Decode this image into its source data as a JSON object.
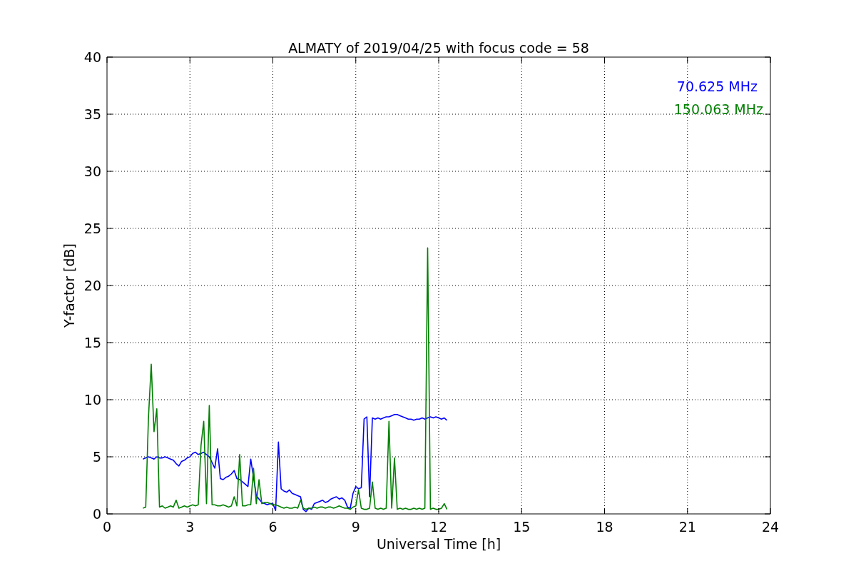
{
  "chart_data": {
    "type": "line",
    "title": "ALMATY of 2019/04/25 with focus code = 58",
    "xlabel": "Universal Time [h]",
    "ylabel": "Y-factor [dB]",
    "xlim": [
      0,
      24
    ],
    "ylim": [
      0,
      40
    ],
    "xticks": [
      0,
      3,
      6,
      9,
      12,
      15,
      18,
      21,
      24
    ],
    "yticks": [
      0,
      5,
      10,
      15,
      20,
      25,
      30,
      35,
      40
    ],
    "grid": true,
    "x": [
      1.3,
      1.4,
      1.5,
      1.6,
      1.7,
      1.8,
      1.9,
      2.0,
      2.1,
      2.2,
      2.3,
      2.4,
      2.5,
      2.6,
      2.7,
      2.8,
      2.9,
      3.0,
      3.1,
      3.2,
      3.3,
      3.4,
      3.5,
      3.6,
      3.7,
      3.8,
      3.9,
      4.0,
      4.1,
      4.2,
      4.3,
      4.4,
      4.5,
      4.6,
      4.7,
      4.8,
      4.9,
      5.0,
      5.1,
      5.2,
      5.3,
      5.4,
      5.5,
      5.6,
      5.7,
      5.8,
      5.9,
      6.0,
      6.1,
      6.2,
      6.3,
      6.4,
      6.5,
      6.6,
      6.7,
      6.8,
      6.9,
      7.0,
      7.1,
      7.2,
      7.3,
      7.4,
      7.5,
      7.6,
      7.7,
      7.8,
      7.9,
      8.0,
      8.1,
      8.2,
      8.3,
      8.4,
      8.5,
      8.6,
      8.7,
      8.8,
      8.9,
      9.0,
      9.1,
      9.2,
      9.3,
      9.4,
      9.5,
      9.6,
      9.7,
      9.8,
      9.9,
      10.0,
      10.1,
      10.2,
      10.3,
      10.4,
      10.5,
      10.6,
      10.7,
      10.8,
      10.9,
      11.0,
      11.1,
      11.2,
      11.3,
      11.4,
      11.5,
      11.6,
      11.7,
      11.8,
      11.9,
      12.0,
      12.1,
      12.2,
      12.3
    ],
    "series": [
      {
        "name": "70.625 MHz",
        "color": "#0000ff",
        "values": [
          4.8,
          4.9,
          5.0,
          4.9,
          4.8,
          5.0,
          4.9,
          4.9,
          5.0,
          4.9,
          4.8,
          4.7,
          4.4,
          4.2,
          4.6,
          4.7,
          4.9,
          5.0,
          5.3,
          5.4,
          5.2,
          5.3,
          5.4,
          5.2,
          5.0,
          4.5,
          4.0,
          5.7,
          3.1,
          3.0,
          3.2,
          3.3,
          3.5,
          3.8,
          3.1,
          3.0,
          2.8,
          2.6,
          2.4,
          4.8,
          3.2,
          1.6,
          1.3,
          1.0,
          0.9,
          0.8,
          0.9,
          0.9,
          0.3,
          6.3,
          2.2,
          2.0,
          1.9,
          2.1,
          1.8,
          1.7,
          1.6,
          1.5,
          0.4,
          0.2,
          0.5,
          0.4,
          0.9,
          1.0,
          1.1,
          1.2,
          1.0,
          1.1,
          1.3,
          1.4,
          1.5,
          1.3,
          1.4,
          1.2,
          0.6,
          0.5,
          1.8,
          2.4,
          2.2,
          2.3,
          8.3,
          8.5,
          1.5,
          8.4,
          8.3,
          8.4,
          8.3,
          8.4,
          8.5,
          8.5,
          8.6,
          8.7,
          8.7,
          8.6,
          8.5,
          8.4,
          8.3,
          8.3,
          8.2,
          8.3,
          8.3,
          8.4,
          8.3,
          8.4,
          8.5,
          8.4,
          8.5,
          8.4,
          8.3,
          8.4,
          8.2
        ]
      },
      {
        "name": "150.063 MHz",
        "color": "#008000",
        "values": [
          0.5,
          0.6,
          8.4,
          13.1,
          7.2,
          9.2,
          0.6,
          0.7,
          0.5,
          0.6,
          0.7,
          0.6,
          1.2,
          0.5,
          0.6,
          0.7,
          0.6,
          0.7,
          0.8,
          0.7,
          0.8,
          6.0,
          8.1,
          0.9,
          9.5,
          0.8,
          0.8,
          0.7,
          0.7,
          0.8,
          0.7,
          0.6,
          0.7,
          1.5,
          0.7,
          5.2,
          0.7,
          0.7,
          0.8,
          0.8,
          4.0,
          0.9,
          3.0,
          0.9,
          1.0,
          1.0,
          0.9,
          0.8,
          0.8,
          0.7,
          0.6,
          0.5,
          0.6,
          0.5,
          0.5,
          0.6,
          0.5,
          1.2,
          0.5,
          0.4,
          0.5,
          0.5,
          0.6,
          0.5,
          0.6,
          0.6,
          0.5,
          0.6,
          0.6,
          0.5,
          0.6,
          0.7,
          0.6,
          0.5,
          0.5,
          0.4,
          0.6,
          0.7,
          2.1,
          0.5,
          0.4,
          0.4,
          0.5,
          2.8,
          0.5,
          0.4,
          0.5,
          0.4,
          0.5,
          8.1,
          0.5,
          4.9,
          0.4,
          0.5,
          0.4,
          0.5,
          0.4,
          0.4,
          0.5,
          0.4,
          0.5,
          0.4,
          0.5,
          23.3,
          0.4,
          0.5,
          0.4,
          0.4,
          0.5,
          0.9,
          0.4
        ]
      }
    ]
  }
}
